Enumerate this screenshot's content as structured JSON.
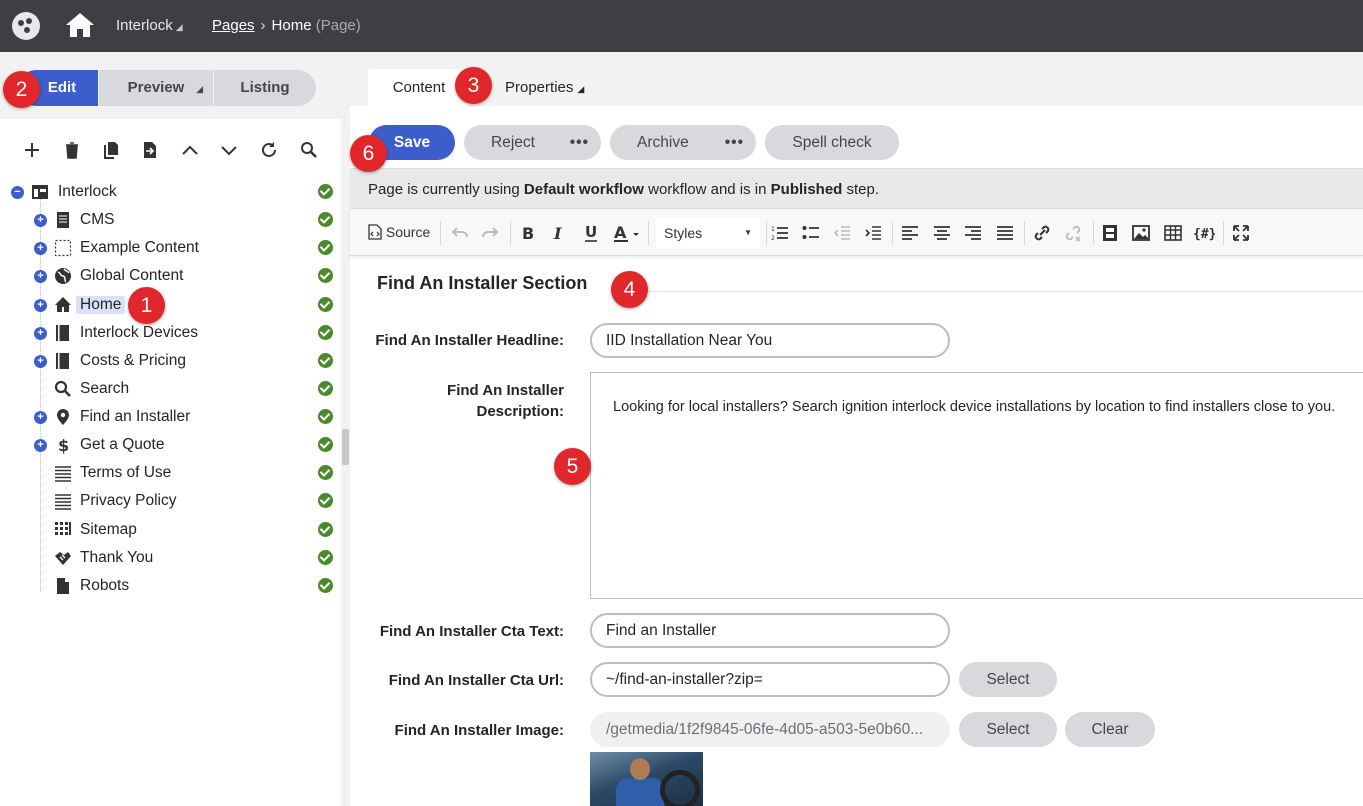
{
  "topbar": {
    "site_name": "Interlock",
    "breadcrumb": {
      "root": "Pages",
      "current": "Home",
      "current_type": "(Page)"
    }
  },
  "modes": {
    "edit": "Edit",
    "preview": "Preview",
    "listing": "Listing"
  },
  "tree": {
    "tools": [
      "add-icon",
      "trash-icon",
      "copy-icon",
      "move-icon",
      "up-icon",
      "down-icon",
      "refresh-icon",
      "search-icon"
    ],
    "items": [
      {
        "label": "Interlock",
        "icon": "site-icon"
      },
      {
        "label": "CMS",
        "icon": "document-icon"
      },
      {
        "label": "Example Content",
        "icon": "dotted-box-icon"
      },
      {
        "label": "Global Content",
        "icon": "globe-icon"
      },
      {
        "label": "Home",
        "icon": "home-icon"
      },
      {
        "label": "Interlock Devices",
        "icon": "book-icon"
      },
      {
        "label": "Costs & Pricing",
        "icon": "book-icon"
      },
      {
        "label": "Search",
        "icon": "search-icon"
      },
      {
        "label": "Find an Installer",
        "icon": "pin-icon"
      },
      {
        "label": "Get a Quote",
        "icon": "dollar-icon"
      },
      {
        "label": "Terms of Use",
        "icon": "lines-icon"
      },
      {
        "label": "Privacy Policy",
        "icon": "lines-icon"
      },
      {
        "label": "Sitemap",
        "icon": "grid-icon"
      },
      {
        "label": "Thank You",
        "icon": "handshake-icon"
      },
      {
        "label": "Robots",
        "icon": "file-icon"
      }
    ]
  },
  "tabs": {
    "content": "Content",
    "properties": "Properties"
  },
  "actions": {
    "save": "Save",
    "reject": "Reject",
    "archive": "Archive",
    "spell_check": "Spell check",
    "more": "•••"
  },
  "workflow": {
    "prefix": "Page is currently using ",
    "workflow_name": "Default workflow",
    "middle": " workflow and is in ",
    "step": "Published",
    "suffix": " step."
  },
  "editor": {
    "source": "Source",
    "styles": "Styles"
  },
  "form": {
    "section_title": "Find An Installer Section",
    "headline_label": "Find An Installer Headline:",
    "headline_value": "IID Installation Near You",
    "description_label_1": "Find An Installer",
    "description_label_2": "Description:",
    "description_value": "Looking for local installers? Search ignition interlock device installations by location to find installers close to you.",
    "cta_text_label": "Find An Installer Cta Text:",
    "cta_text_value": "Find an Installer",
    "cta_url_label": "Find An Installer Cta Url:",
    "cta_url_value": "~/find-an-installer?zip=",
    "image_label": "Find An Installer Image:",
    "image_value": "/getmedia/1f2f9845-06fe-4d05-a503-5e0b60...",
    "select": "Select",
    "clear": "Clear"
  },
  "badges": [
    "1",
    "2",
    "3",
    "4",
    "5",
    "6"
  ],
  "colors": {
    "accent": "#3b5ecc",
    "badge": "#e0282c",
    "topbar": "#3e3f44",
    "ok": "#4a8a2a"
  }
}
